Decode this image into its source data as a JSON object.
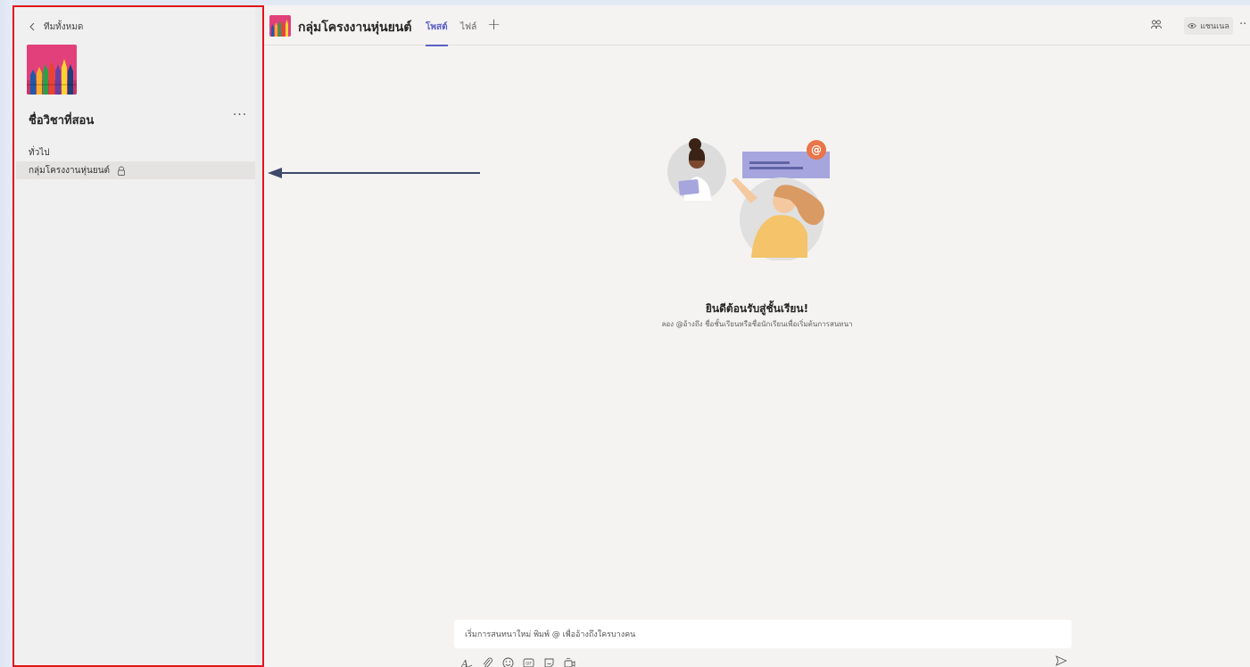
{
  "sidebar": {
    "back_label": "ทีมทั้งหมด",
    "team_name": "ชื่อวิชาที่สอน",
    "more_label": "···",
    "channels": [
      {
        "label": "ทั่วไป",
        "locked": false
      },
      {
        "label": "กลุ่มโครงงานหุ่นยนต์",
        "locked": true
      }
    ]
  },
  "header": {
    "channel_title": "กลุ่มโครงงานหุ่นยนต์",
    "tabs": [
      {
        "label": "โพสต์",
        "active": true
      },
      {
        "label": "ไฟล์",
        "active": false
      }
    ],
    "add_tab": "+",
    "channel_button": "แชนเนล",
    "more_label": "··"
  },
  "welcome": {
    "title": "ยินดีต้อนรับสู่ชั้นเรียน!",
    "subtitle": "ลอง @อ้างถึง ชื่อชั้นเรียนหรือชื่อนักเรียนเพื่อเริ่มต้นการสนทนา"
  },
  "compose": {
    "placeholder": "เริ่มการสนทนาใหม่ พิมพ์ @ เพื่ออ้างถึงใครบางคน",
    "toolbar_icons": [
      "format-icon",
      "attach-icon",
      "emoji-icon",
      "gif-icon",
      "sticker-icon",
      "meet-now-icon"
    ]
  },
  "colors": {
    "accent": "#5b5fc7",
    "highlight_border": "#e3131b",
    "arrow": "#3d4a6b"
  }
}
